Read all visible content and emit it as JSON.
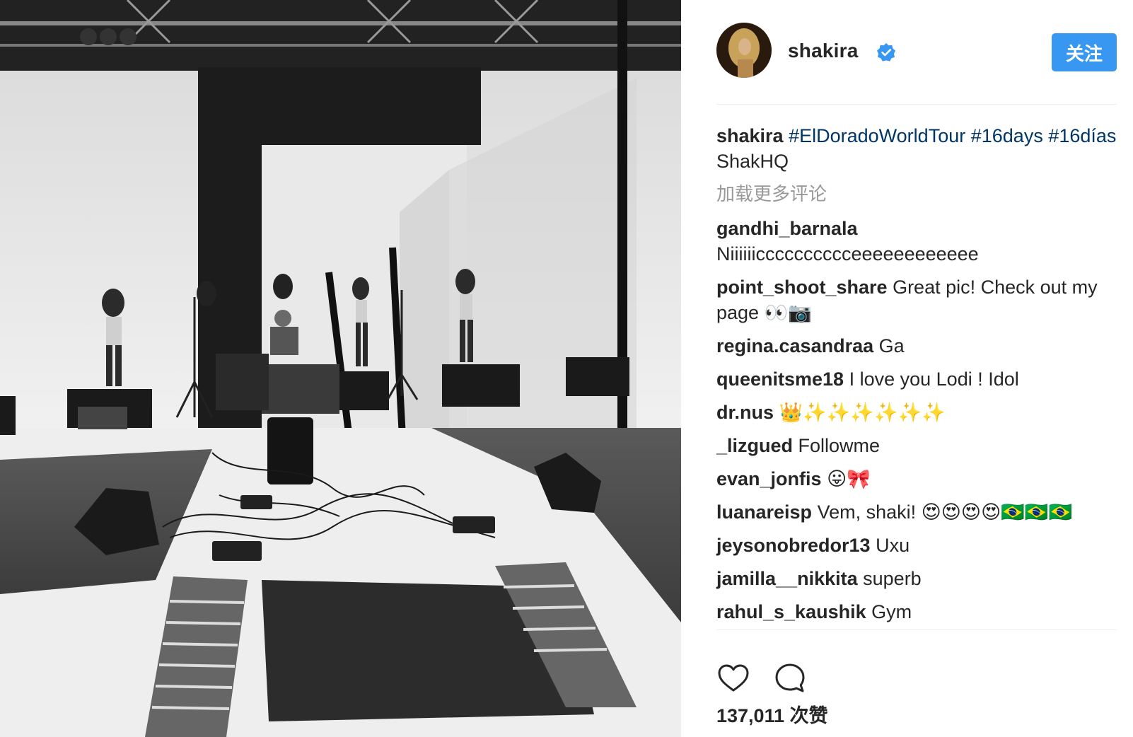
{
  "post": {
    "author": {
      "username": "shakira",
      "verified": true
    },
    "follow_label": "关注",
    "caption": {
      "username": "shakira",
      "hashtags": [
        "#ElDoradoWorldTour",
        "#16days",
        "#16días"
      ],
      "text": "ShakHQ"
    },
    "load_more_label": "加载更多评论",
    "comments": [
      {
        "user": "gandhi_barnala",
        "text": "Niiiiiicccccccccceeeeeeeeeeee"
      },
      {
        "user": "point_shoot_share",
        "text": "Great pic! Check out my page 👀📷"
      },
      {
        "user": "regina.casandraa",
        "text": "Ga"
      },
      {
        "user": "queenitsme18",
        "text": "I love you Lodi ! Idol"
      },
      {
        "user": "dr.nus",
        "text": "👑✨✨✨✨✨✨"
      },
      {
        "user": "_lizgued",
        "text": "Followme"
      },
      {
        "user": "evan_jonfis",
        "text": "😛🎀"
      },
      {
        "user": "luanareisp",
        "text": "Vem, shaki! 😍😍😍😍🇧🇷🇧🇷🇧🇷"
      },
      {
        "user": "jeysonobredor13",
        "text": "Uxu"
      },
      {
        "user": "jamilla__nikkita",
        "text": "superb"
      },
      {
        "user": "rahul_s_kaushik",
        "text": "Gym"
      }
    ],
    "likes": {
      "count": "137,011",
      "unit": "次赞"
    },
    "icons": {
      "like": "heart-outline-icon",
      "comment": "comment-bubble-icon",
      "verified": "verified-badge-icon"
    },
    "colors": {
      "accent": "#3897f0",
      "hashtag": "#003569",
      "muted": "#999999",
      "text": "#262626"
    }
  }
}
